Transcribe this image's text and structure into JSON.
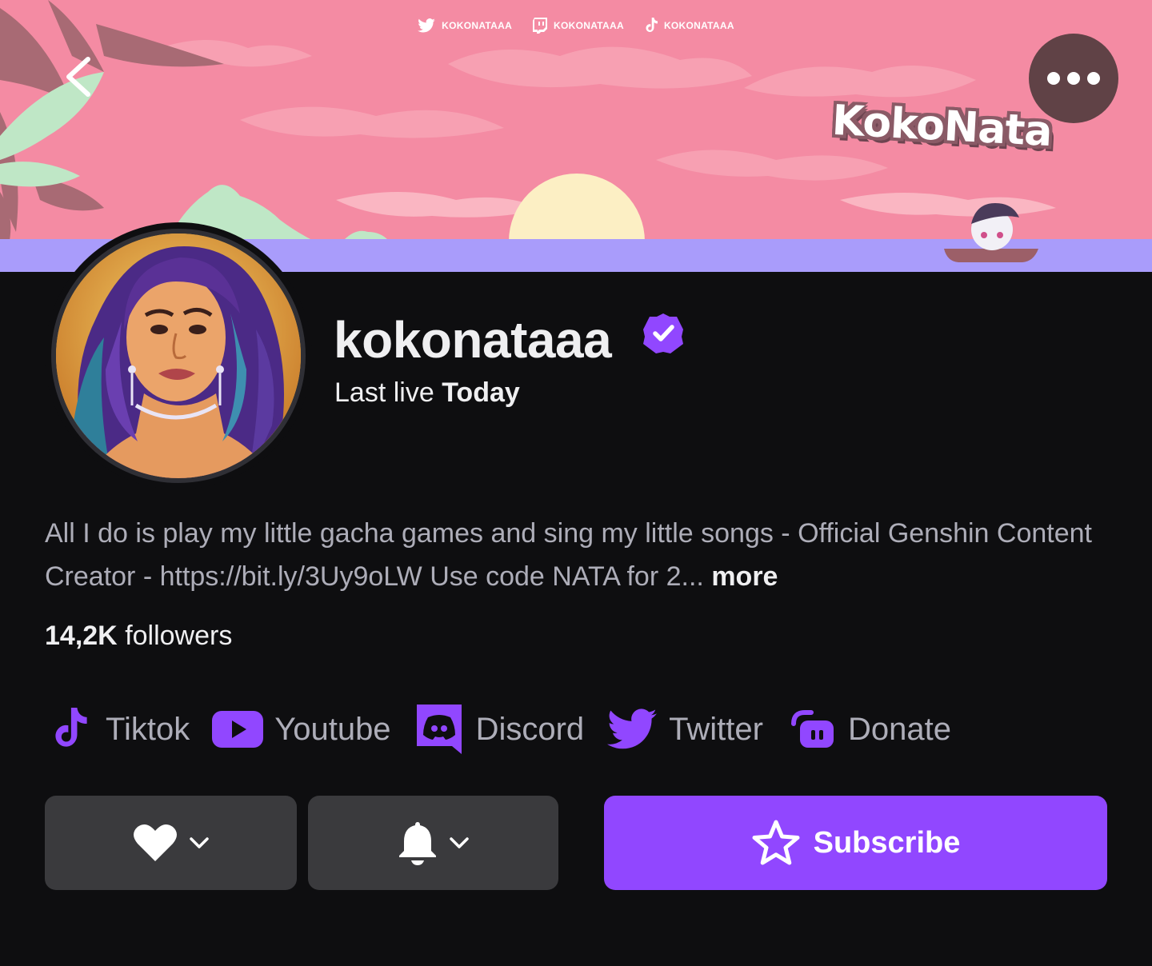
{
  "banner": {
    "socials": [
      {
        "icon": "twitter-icon",
        "label": "KOKONATAAA"
      },
      {
        "icon": "twitch-icon",
        "label": "KOKONATAAA"
      },
      {
        "icon": "tiktok-icon",
        "label": "KOKONATAAA"
      }
    ],
    "logo_text": "KokoNata",
    "back_icon": "chevron-left-icon",
    "more_icon": "more-options-icon",
    "colors": {
      "sky": "#f48ba3",
      "water": "#a99cfb",
      "sun": "#fcefc4"
    }
  },
  "profile": {
    "channel_name": "kokonataaa",
    "verified_icon": "verified-badge-icon",
    "last_live_prefix": "Last live",
    "last_live_value": "Today",
    "bio": "All I do is play my little gacha games and sing my little songs - Official Genshin Content Creator - https://bit.ly/3Uy9oLW Use code NATA for 2...",
    "bio_more": "more",
    "followers_count": "14,2K",
    "followers_label": "followers"
  },
  "links": [
    {
      "icon": "tiktok-icon",
      "label": "Tiktok"
    },
    {
      "icon": "youtube-icon",
      "label": "Youtube"
    },
    {
      "icon": "discord-icon",
      "label": "Discord"
    },
    {
      "icon": "twitter-icon",
      "label": "Twitter"
    },
    {
      "icon": "streamlabs-icon",
      "label": "Donate"
    }
  ],
  "actions": {
    "follow_icon": "heart-icon",
    "notify_icon": "bell-icon",
    "subscribe_icon": "star-icon",
    "subscribe_label": "Subscribe"
  },
  "colors": {
    "background": "#0e0e10",
    "accent": "#9147ff",
    "text_primary": "#efeff1",
    "text_secondary": "#adadb8",
    "button_secondary": "#3a3a3d"
  }
}
